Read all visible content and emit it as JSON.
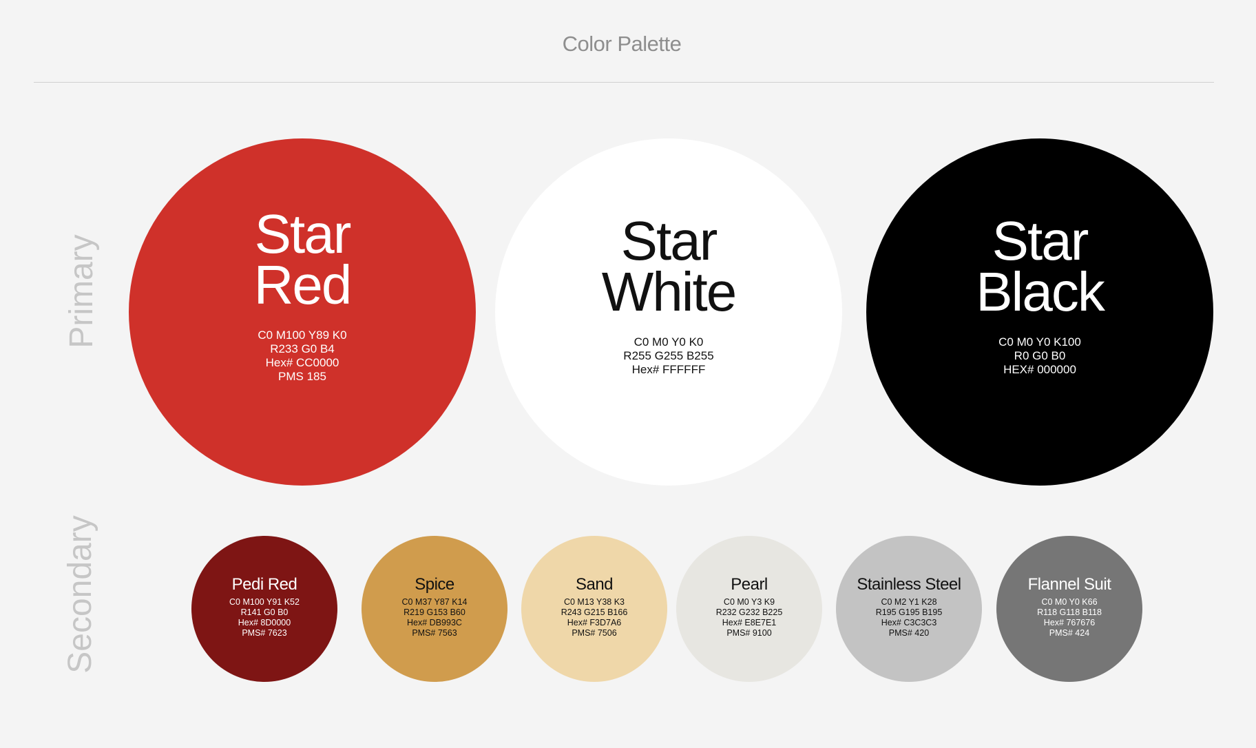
{
  "header": {
    "title": "Color Palette"
  },
  "sections": {
    "primary": "Primary",
    "secondary": "Secondary"
  },
  "primary": [
    {
      "name1": "Star",
      "name2": "Red",
      "bg": "#CF312A",
      "fg": "#FFFFFF",
      "specs": [
        "C0 M100 Y89 K0",
        "R233 G0 B4",
        "Hex# CC0000",
        "PMS 185"
      ]
    },
    {
      "name1": "Star",
      "name2": "White",
      "bg": "#FFFFFF",
      "fg": "#111111",
      "specs": [
        "C0 M0 Y0 K0",
        "R255 G255 B255",
        "Hex# FFFFFF"
      ]
    },
    {
      "name1": "Star",
      "name2": "Black",
      "bg": "#000000",
      "fg": "#FFFFFF",
      "specs": [
        "C0 M0 Y0 K100",
        "R0 G0 B0",
        "HEX# 000000"
      ]
    }
  ],
  "secondary": [
    {
      "name": "Pedi Red",
      "bg": "#7E1514",
      "fg": "#FFFFFF",
      "specs": [
        "C0 M100 Y91 K52",
        "R141 G0 B0",
        "Hex# 8D0000",
        "PMS# 7623"
      ]
    },
    {
      "name": "Spice",
      "bg": "#D09C4D",
      "fg": "#111111",
      "specs": [
        "C0 M37 Y87 K14",
        "R219 G153 B60",
        "Hex# DB993C",
        "PMS# 7563"
      ]
    },
    {
      "name": "Sand",
      "bg": "#EFD7A9",
      "fg": "#111111",
      "specs": [
        "C0 M13 Y38 K3",
        "R243 G215 B166",
        "Hex# F3D7A6",
        "PMS# 7506"
      ]
    },
    {
      "name": "Pearl",
      "bg": "#E7E6E1",
      "fg": "#111111",
      "specs": [
        "C0 M0 Y3 K9",
        "R232 G232 B225",
        "Hex# E8E7E1",
        "PMS# 9100"
      ]
    },
    {
      "name": "Stainless Steel",
      "bg": "#C3C3C3",
      "fg": "#111111",
      "specs": [
        "C0 M2 Y1 K28",
        "R195 G195 B195",
        "Hex# C3C3C3",
        "PMS# 420"
      ]
    },
    {
      "name": "Flannel Suit",
      "bg": "#767676",
      "fg": "#FFFFFF",
      "specs": [
        "C0 M0 Y0 K66",
        "R118 G118 B118",
        "Hex# 767676",
        "PMS# 424"
      ]
    }
  ]
}
